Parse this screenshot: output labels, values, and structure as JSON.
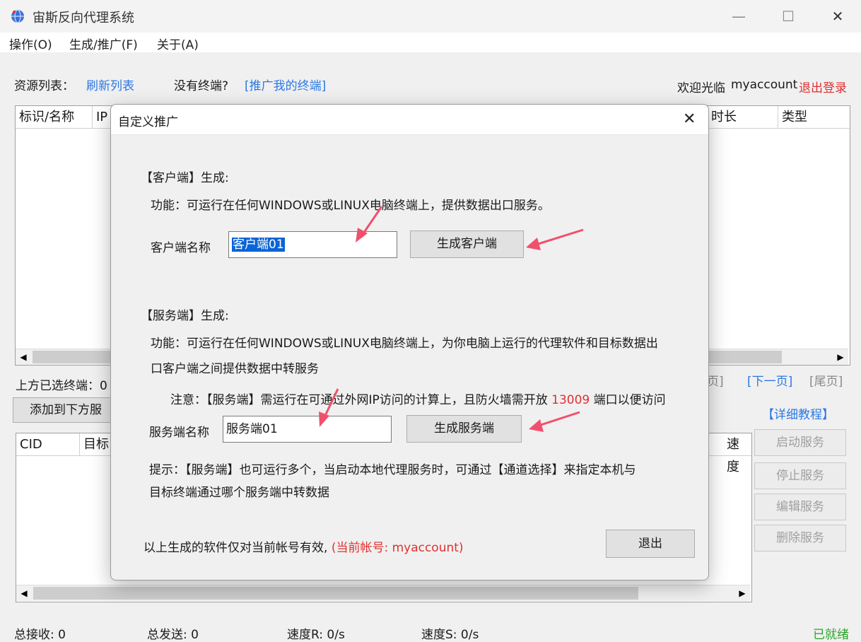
{
  "window": {
    "title": "宙斯反向代理系统",
    "minimize": "—",
    "maximize": "☐",
    "close": "✕"
  },
  "menu": [
    "操作(O)",
    "生成/推广(F)",
    "关于(A)"
  ],
  "toolbar": {
    "resource_label": "资源列表：",
    "refresh_link": "刷新列表",
    "no_terminal": "没有终端?",
    "promote_link": "[推广我的终端]",
    "welcome": "欢迎光临",
    "username": "myaccount",
    "logout": "退出登录"
  },
  "upper_list": {
    "columns": [
      "标识/名称",
      "IP",
      "时长",
      "类型"
    ]
  },
  "selected": {
    "label": "上方已选终端：0",
    "add_button": "添加到下方服",
    "pager_prev": "页]",
    "pager_next": "[下一页]",
    "pager_last": "[尾页]"
  },
  "lower_list": {
    "columns": [
      "CID",
      "目标",
      "速度"
    ]
  },
  "side": {
    "tutorial": "【详细教程】",
    "buttons": [
      "启动服务",
      "停止服务",
      "编辑服务",
      "删除服务"
    ]
  },
  "status": {
    "recv": "总接收: 0",
    "send": "总发送: 0",
    "speed_r": "速度R:  0/s",
    "speed_s": "速度S:  0/s",
    "ready": "已就绪"
  },
  "dialog": {
    "title": "自定义推广",
    "close": "✕",
    "client_heading": "【客户端】生成:",
    "client_func": "功能：可运行在任何WINDOWS或LINUX电脑终端上，提供数据出口服务。",
    "client_name_label": "客户端名称",
    "client_name_value": "客户端01",
    "client_button": "生成客户端",
    "server_heading": "【服务端】生成:",
    "server_func_line1": "功能：可运行在任何WINDOWS或LINUX电脑终端上，为你电脑上运行的代理软件和目标数据出",
    "server_func_line2": "口客户端之间提供数据中转服务",
    "note_prefix": "注意：【服务端】需运行在可通过外网IP访问的计算上，且防火墙需开放",
    "note_port": "13009",
    "note_suffix": "端口以便访问",
    "server_name_label": "服务端名称",
    "server_name_value": "服务端01",
    "server_button": "生成服务端",
    "hint_line1": "提示：【服务端】也可运行多个，当启动本地代理服务时，可通过【通道选择】来指定本机与",
    "hint_line2": "目标终端通过哪个服务端中转数据",
    "footer_text": "以上生成的软件仅对当前帐号有效,",
    "footer_account": "(当前帐号: myaccount)",
    "exit_button": "退出"
  },
  "colors": {
    "link": "#2b78e4",
    "warning": "#e03030",
    "ready": "#2aa52a",
    "selection": "#0a64d6",
    "arrow": "#f0506e"
  }
}
